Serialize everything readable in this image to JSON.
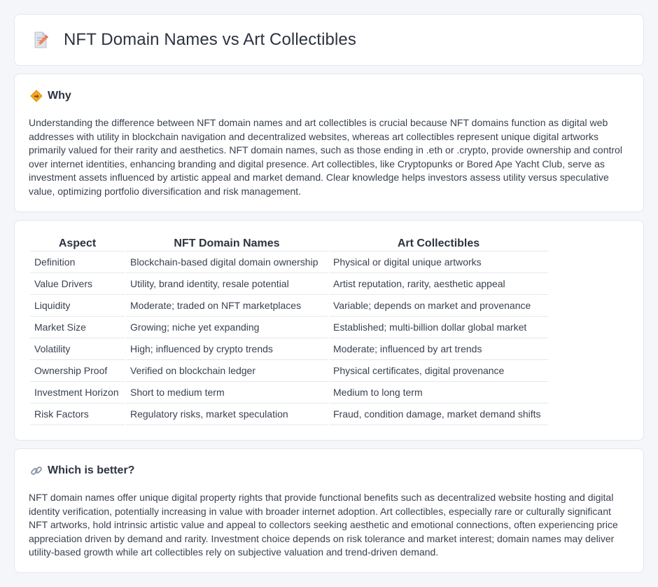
{
  "header": {
    "title": "NFT Domain Names vs Art Collectibles",
    "icon": "edit-document-icon"
  },
  "why": {
    "title": "Why",
    "icon": "diamond-sign-icon",
    "text": "Understanding the difference between NFT domain names and art collectibles is crucial because NFT domains function as digital web addresses with utility in blockchain navigation and decentralized websites, whereas art collectibles represent unique digital artworks primarily valued for their rarity and aesthetics. NFT domain names, such as those ending in .eth or .crypto, provide ownership and control over internet identities, enhancing branding and digital presence. Art collectibles, like Cryptopunks or Bored Ape Yacht Club, serve as investment assets influenced by artistic appeal and market demand. Clear knowledge helps investors assess utility versus speculative value, optimizing portfolio diversification and risk management."
  },
  "comparison": {
    "headers": [
      "Aspect",
      "NFT Domain Names",
      "Art Collectibles"
    ],
    "rows": [
      [
        "Definition",
        "Blockchain-based digital domain ownership",
        "Physical or digital unique artworks"
      ],
      [
        "Value Drivers",
        "Utility, brand identity, resale potential",
        "Artist reputation, rarity, aesthetic appeal"
      ],
      [
        "Liquidity",
        "Moderate; traded on NFT marketplaces",
        "Variable; depends on market and provenance"
      ],
      [
        "Market Size",
        "Growing; niche yet expanding",
        "Established; multi-billion dollar global market"
      ],
      [
        "Volatility",
        "High; influenced by crypto trends",
        "Moderate; influenced by art trends"
      ],
      [
        "Ownership Proof",
        "Verified on blockchain ledger",
        "Physical certificates, digital provenance"
      ],
      [
        "Investment Horizon",
        "Short to medium term",
        "Medium to long term"
      ],
      [
        "Risk Factors",
        "Regulatory risks, market speculation",
        "Fraud, condition damage, market demand shifts"
      ]
    ]
  },
  "better": {
    "title": "Which is better?",
    "icon": "link-icon",
    "text": "NFT domain names offer unique digital property rights that provide functional benefits such as decentralized website hosting and digital identity verification, potentially increasing in value with broader internet adoption. Art collectibles, especially rare or culturally significant NFT artworks, hold intrinsic artistic value and appeal to collectors seeking aesthetic and emotional connections, often experiencing price appreciation driven by demand and rarity. Investment choice depends on risk tolerance and market interest; domain names may deliver utility-based growth while art collectibles rely on subjective valuation and trend-driven demand."
  }
}
